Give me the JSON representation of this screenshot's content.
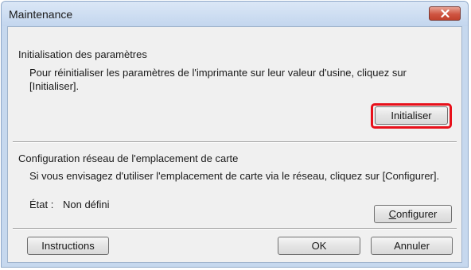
{
  "window": {
    "title": "Maintenance"
  },
  "reset_section": {
    "title": "Initialisation des paramètres",
    "description": "Pour réinitialiser les paramètres de l'imprimante sur leur valeur d'usine, cliquez sur [Initialiser].",
    "button_label": "Initialiser",
    "highlight_color": "#e8101a"
  },
  "network_section": {
    "title": "Configuration réseau de l'emplacement de carte",
    "description": "Si vous envisagez d'utiliser l'emplacement de carte via le réseau, cliquez sur [Configurer].",
    "status_label": "État :",
    "status_value": "Non défini",
    "button_label": "Configurer"
  },
  "footer": {
    "instructions_label": "Instructions",
    "ok_label": "OK",
    "cancel_label": "Annuler"
  },
  "icons": {
    "close": "close-icon"
  }
}
